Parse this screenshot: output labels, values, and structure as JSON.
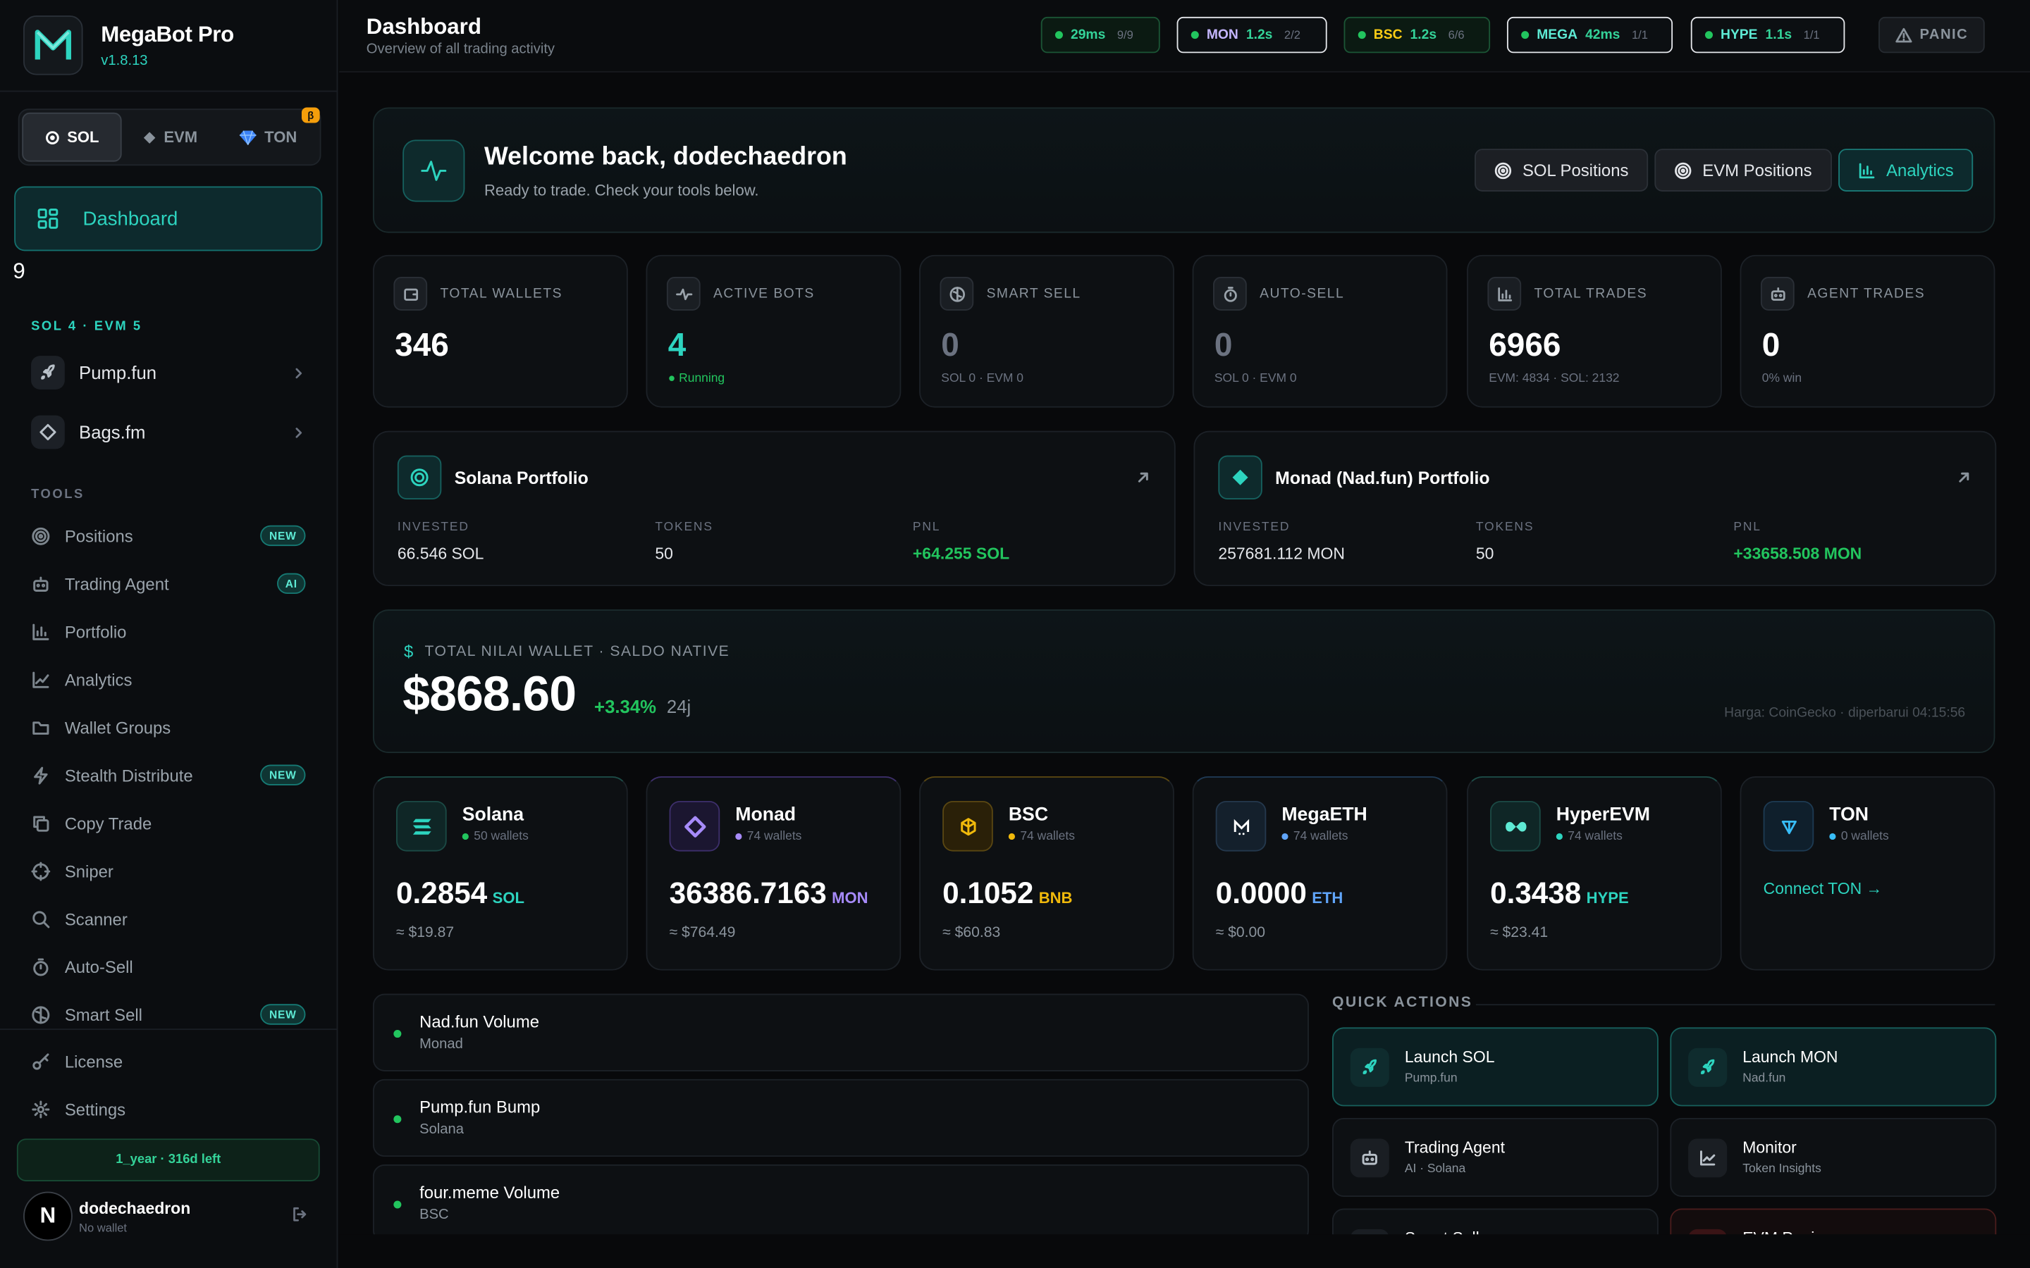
{
  "app": {
    "name": "MegaBot Pro",
    "version": "v1.8.13"
  },
  "chain_switch": [
    {
      "label": "SOL",
      "active": true
    },
    {
      "label": "EVM"
    },
    {
      "label": "TON",
      "badge": "β"
    }
  ],
  "nav": {
    "dashboard": "Dashboard",
    "count": "9",
    "platforms_label": "SOL 4 · EVM 5",
    "platforms": [
      "Pump.fun",
      "Bags.fm"
    ],
    "tools_label": "TOOLS",
    "tools": [
      {
        "label": "Positions",
        "icon": "target-icon",
        "tag": "NEW"
      },
      {
        "label": "Trading Agent",
        "icon": "bot-icon",
        "tag": "AI"
      },
      {
        "label": "Portfolio",
        "icon": "bar-chart-icon"
      },
      {
        "label": "Analytics",
        "icon": "line-chart-icon"
      },
      {
        "label": "Wallet Groups",
        "icon": "folder-icon"
      },
      {
        "label": "Stealth Distribute",
        "icon": "zap-icon",
        "tag": "NEW"
      },
      {
        "label": "Copy Trade",
        "icon": "copy-icon"
      },
      {
        "label": "Sniper",
        "icon": "crosshair-icon"
      },
      {
        "label": "Scanner",
        "icon": "search-icon"
      },
      {
        "label": "Auto-Sell",
        "icon": "timer-icon"
      },
      {
        "label": "Smart Sell",
        "icon": "brain-icon",
        "tag": "NEW"
      }
    ],
    "license": "License",
    "settings": "Settings"
  },
  "license_status": "1_year · 316d left",
  "user": {
    "initial": "N",
    "name": "dodechaedron",
    "sub": "No wallet"
  },
  "header": {
    "title": "Dashboard",
    "subtitle": "Overview of all trading activity",
    "panic": "PANIC"
  },
  "status_pills": [
    {
      "latency": "29ms",
      "count": "9/9"
    },
    {
      "chain": "MON",
      "latency": "1.2s",
      "count": "2/2"
    },
    {
      "chain": "BSC",
      "latency": "1.2s",
      "count": "6/6"
    },
    {
      "chain": "MEGA",
      "latency": "42ms",
      "count": "1/1"
    },
    {
      "chain": "HYPE",
      "latency": "1.1s",
      "count": "1/1"
    }
  ],
  "welcome": {
    "title": "Welcome back, dodechaedron",
    "subtitle": "Ready to trade. Check your tools below.",
    "buttons": [
      "SOL Positions",
      "EVM Positions",
      "Analytics"
    ]
  },
  "stats": [
    {
      "label": "TOTAL WALLETS",
      "value": "346",
      "sub": ""
    },
    {
      "label": "ACTIVE BOTS",
      "value": "4",
      "sub": "● Running"
    },
    {
      "label": "SMART SELL",
      "value": "0",
      "sub": "SOL 0 · EVM 0"
    },
    {
      "label": "AUTO-SELL",
      "value": "0",
      "sub": "SOL 0 · EVM 0"
    },
    {
      "label": "TOTAL TRADES",
      "value": "6966",
      "sub": "EVM: 4834 · SOL: 2132"
    },
    {
      "label": "AGENT TRADES",
      "value": "0",
      "sub": "0% win"
    }
  ],
  "portfolios": [
    {
      "title": "Solana Portfolio",
      "invested_label": "INVESTED",
      "invested": "66.546 SOL",
      "tokens_label": "TOKENS",
      "tokens": "50",
      "pnl_label": "PNL",
      "pnl": "+64.255 SOL"
    },
    {
      "title": "Monad (Nad.fun) Portfolio",
      "invested_label": "INVESTED",
      "invested": "257681.112 MON",
      "tokens_label": "TOKENS",
      "tokens": "50",
      "pnl_label": "PNL",
      "pnl": "+33658.508 MON"
    }
  ],
  "total_wallet": {
    "label": "TOTAL NILAI WALLET · SALDO NATIVE",
    "value": "$868.60",
    "change": "+3.34%",
    "period": "24j",
    "note": "Harga: CoinGecko · diperbarui 04:15:56"
  },
  "chains": [
    {
      "name": "Solana",
      "wallets": "50 wallets",
      "balance": "0.2854",
      "unit": "SOL",
      "usd": "≈ $19.87",
      "color": "#2dd4bf"
    },
    {
      "name": "Monad",
      "wallets": "74 wallets",
      "balance": "36386.7163",
      "unit": "MON",
      "usd": "≈ $764.49",
      "color": "#a78bfa"
    },
    {
      "name": "BSC",
      "wallets": "74 wallets",
      "balance": "0.1052",
      "unit": "BNB",
      "usd": "≈ $60.83",
      "color": "#f0b90b"
    },
    {
      "name": "MegaETH",
      "wallets": "74 wallets",
      "balance": "0.0000",
      "unit": "ETH",
      "usd": "≈ $0.00",
      "color": "#60a5fa"
    },
    {
      "name": "HyperEVM",
      "wallets": "74 wallets",
      "balance": "0.3438",
      "unit": "HYPE",
      "usd": "≈ $23.41",
      "color": "#2dd4bf"
    },
    {
      "name": "TON",
      "wallets": "0 wallets",
      "connect": "Connect TON →",
      "color": "#38bdf8"
    }
  ],
  "bots": [
    {
      "name": "Nad.fun Volume",
      "chain": "Monad"
    },
    {
      "name": "Pump.fun Bump",
      "chain": "Solana"
    },
    {
      "name": "four.meme Volume",
      "chain": "BSC"
    }
  ],
  "quick_actions": {
    "label": "QUICK ACTIONS",
    "items": [
      {
        "title": "Launch SOL",
        "sub": "Pump.fun"
      },
      {
        "title": "Launch MON",
        "sub": "Nad.fun"
      },
      {
        "title": "Trading Agent",
        "sub": "AI · Solana"
      },
      {
        "title": "Monitor",
        "sub": "Token Insights"
      },
      {
        "title": "Smart Sell",
        "sub": ""
      },
      {
        "title": "EVM Panic",
        "sub": ""
      }
    ]
  }
}
